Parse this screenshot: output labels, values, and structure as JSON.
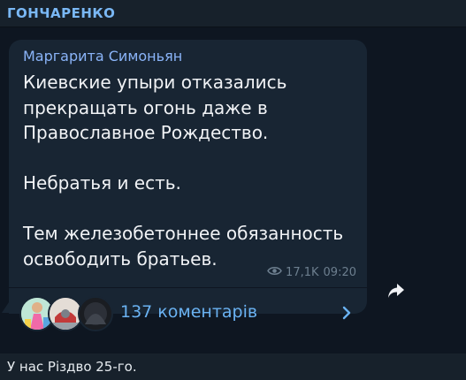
{
  "header": {
    "channel_name": "ГОНЧАРЕНКО"
  },
  "post": {
    "author": "Маргарита Симоньян",
    "paragraphs": [
      "Киевские упыри отказались прекращать огонь даже в Православное Рождество.",
      "Небратья и есть.",
      "Тем железобетоннее обязанность освободить братьев."
    ],
    "views": "17,1K",
    "time": "09:20",
    "comments_label": "137 коментарів",
    "view_icon": "eye-icon",
    "share_icon": "share-arrow-icon"
  },
  "input": {
    "text": "У нас Різдво 25-го."
  },
  "colors": {
    "background": "#0e1621",
    "bubble": "#182533",
    "header": "#17212b",
    "accent": "#6ab2f2",
    "author": "#8ab4f8"
  }
}
